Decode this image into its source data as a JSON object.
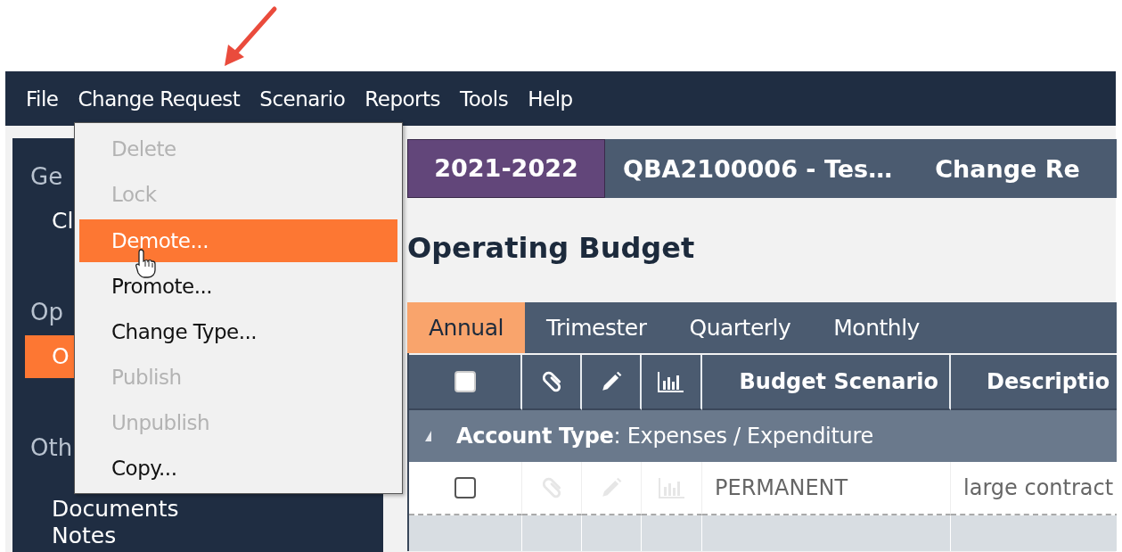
{
  "menubar": [
    {
      "label": "File"
    },
    {
      "label": "Change Request"
    },
    {
      "label": "Scenario"
    },
    {
      "label": "Reports"
    },
    {
      "label": "Tools"
    },
    {
      "label": "Help"
    }
  ],
  "dropdown": {
    "items": [
      {
        "label": "Delete",
        "disabled": true,
        "selected": false
      },
      {
        "label": "Lock",
        "disabled": true,
        "selected": false
      },
      {
        "label": "Demote...",
        "disabled": false,
        "selected": true
      },
      {
        "label": "Promote...",
        "disabled": false,
        "selected": false
      },
      {
        "label": "Change Type...",
        "disabled": false,
        "selected": false
      },
      {
        "label": "Publish",
        "disabled": true,
        "selected": false
      },
      {
        "label": "Unpublish",
        "disabled": true,
        "selected": false
      },
      {
        "label": "Copy...",
        "disabled": false,
        "selected": false
      }
    ]
  },
  "sidebar": {
    "items": [
      {
        "kind": "heading",
        "label": "Ge"
      },
      {
        "kind": "link",
        "label": "Cl",
        "selected": false
      },
      {
        "kind": "heading",
        "label": "Op"
      },
      {
        "kind": "link",
        "label": "O",
        "selected": true
      },
      {
        "kind": "heading",
        "label": "Oth"
      },
      {
        "kind": "link",
        "label": "Documents",
        "selected": false
      },
      {
        "kind": "link",
        "label": "Notes",
        "selected": false
      }
    ]
  },
  "breadcrumb": {
    "year": "2021-2022",
    "record": "QBA2100006 - Tes…",
    "type": "Change Re"
  },
  "title": "Operating Budget",
  "tabs": [
    {
      "label": "Annual",
      "selected": true
    },
    {
      "label": "Trimester",
      "selected": false
    },
    {
      "label": "Quarterly",
      "selected": false
    },
    {
      "label": "Monthly",
      "selected": false
    }
  ],
  "table": {
    "header_checked": false,
    "columns": [
      "Budget Scenario",
      "Descriptio"
    ],
    "group": {
      "label": "**Account Type**: Expenses / Expenditure",
      "expanded": true
    },
    "rows": [
      {
        "checked": false,
        "budget_scenario": "PERMANENT",
        "description": "large contract"
      }
    ]
  }
}
